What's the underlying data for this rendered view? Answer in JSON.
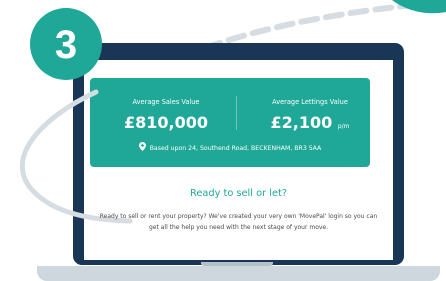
{
  "step": {
    "number": "3"
  },
  "valuation": {
    "sales_label": "Average Sales Value",
    "sales_value": "£810,000",
    "lettings_label": "Average Lettings Value",
    "lettings_value": "£2,100",
    "lettings_unit": "p/m",
    "address_icon": "map-pin-icon",
    "address": "Based upon 24, Southend Road, BECKENHAM, BR3 5AA"
  },
  "cta": {
    "heading": "Ready to sell or let?",
    "body": "Ready to sell or rent your property? We've created your very own 'MovePal' login so you can get all the help you need with the next stage of your move."
  },
  "colors": {
    "accent": "#1fa898",
    "laptop": "#1a3657",
    "laptop_base": "#cdd7dd",
    "dashes": "#d6dde2"
  }
}
